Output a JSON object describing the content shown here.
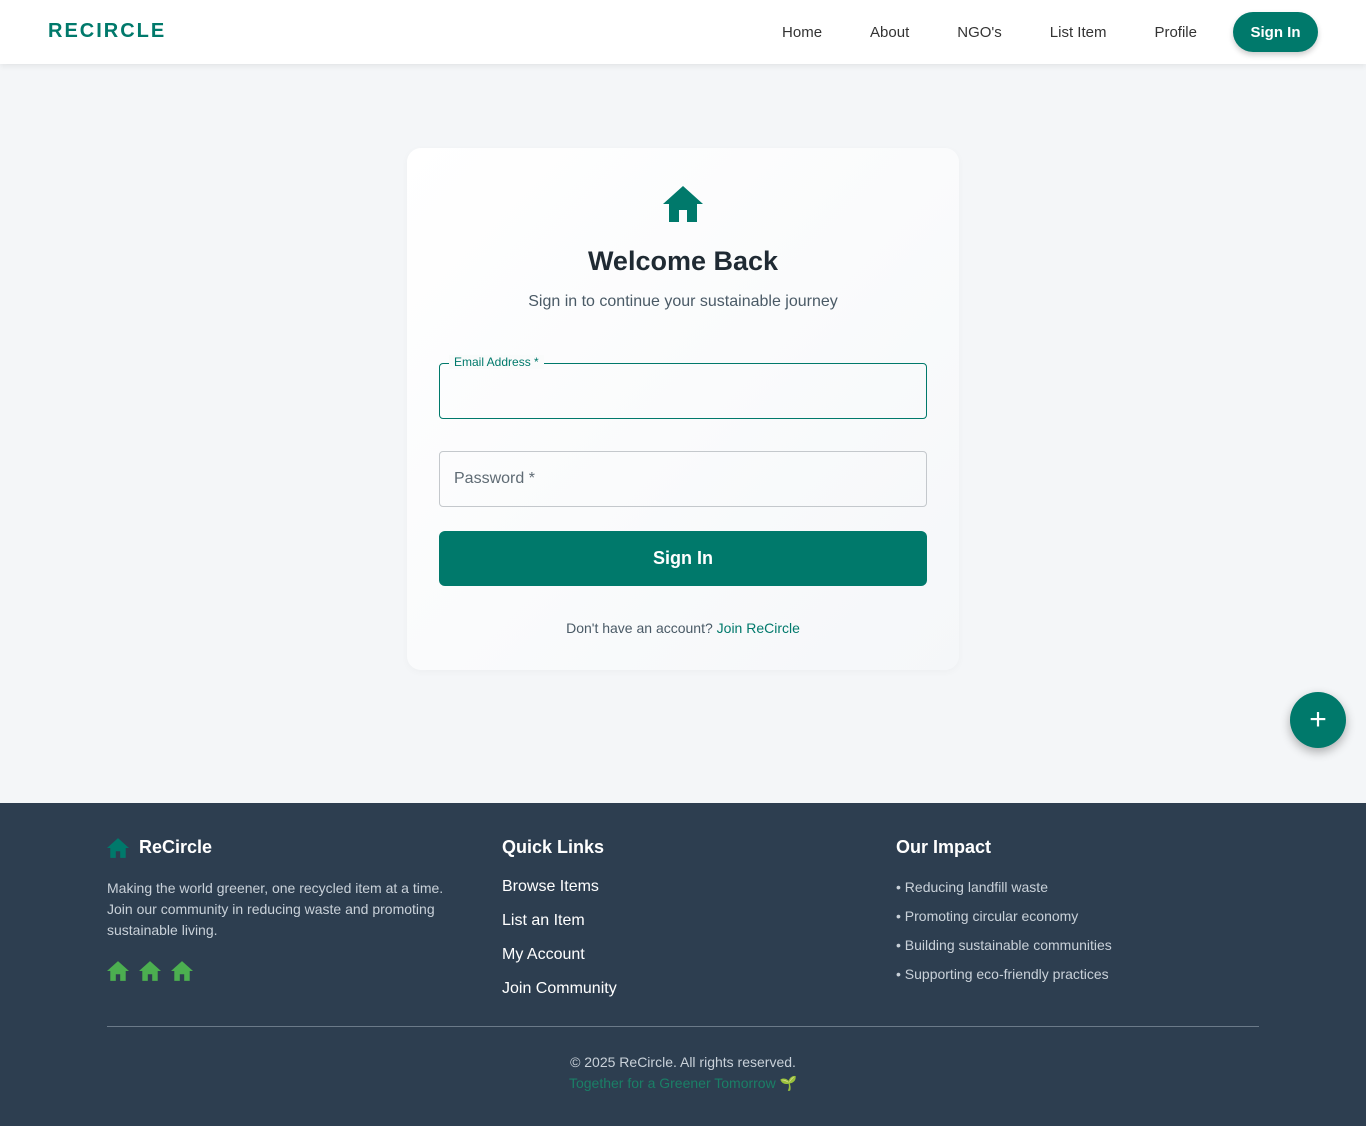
{
  "nav": {
    "brand": "RECIRCLE",
    "links": [
      "Home",
      "About",
      "NGO's",
      "List Item",
      "Profile"
    ],
    "signin": "Sign In"
  },
  "login": {
    "icon": "home-icon",
    "title": "Welcome Back",
    "subtitle": "Sign in to continue your sustainable journey",
    "email_label": "Email Address *",
    "email_value": "",
    "password_label": "Password *",
    "submit": "Sign In",
    "no_account": "Don't have an account?",
    "join_link": "Join ReCircle"
  },
  "fab": {
    "label": "+",
    "icon": "plus-icon"
  },
  "footer": {
    "brand": "ReCircle",
    "description": "Making the world greener, one recycled item at a time. Join our community in reducing waste and promoting sustainable living.",
    "quick_links_title": "Quick Links",
    "quick_links": [
      "Browse Items",
      "List an Item",
      "My Account",
      "Join Community"
    ],
    "impact_title": "Our Impact",
    "impact_items": [
      "• Reducing landfill waste",
      "• Promoting circular economy",
      "• Building sustainable communities",
      "• Supporting eco-friendly practices"
    ],
    "copyright": "© 2025 ReCircle. All rights reserved.",
    "tagline": "Together for a Greener Tomorrow 🌱"
  },
  "colors": {
    "primary": "#00796b",
    "footer_bg": "#2d3e50",
    "eco_green": "#4caf50",
    "page_bg": "#f4f6f8"
  }
}
